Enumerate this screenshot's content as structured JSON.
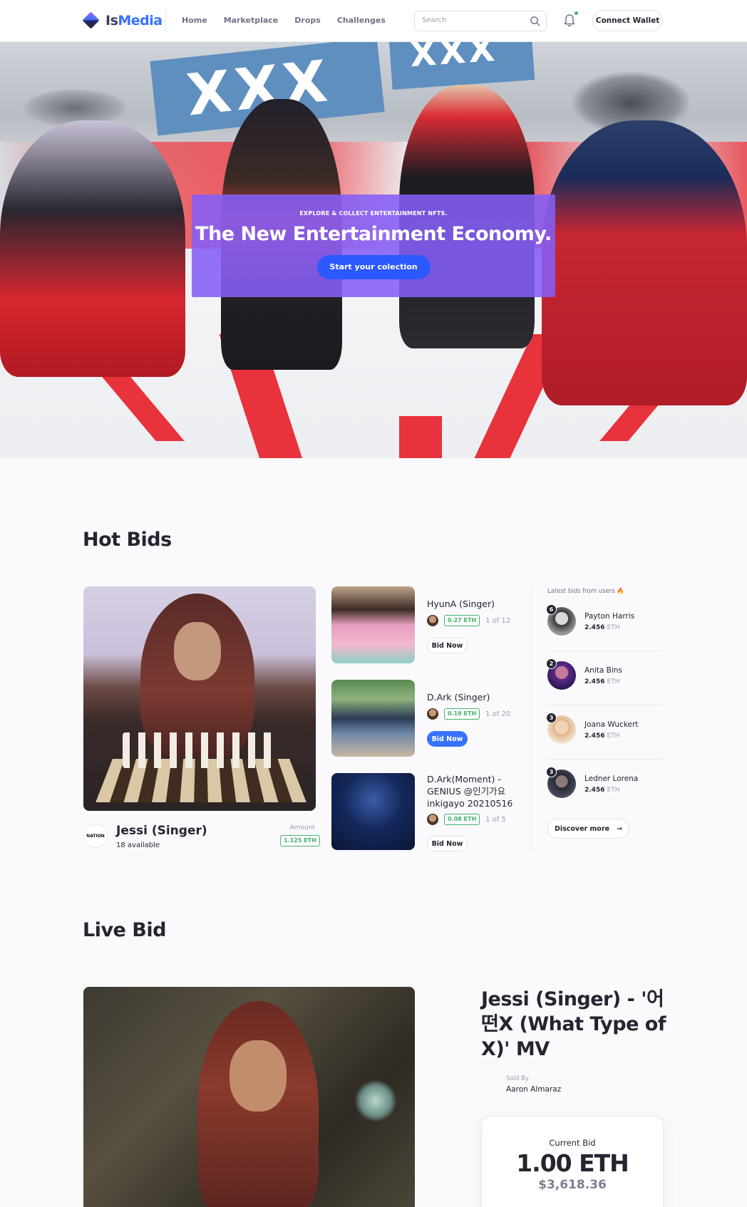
{
  "brand": {
    "name_part1": "Is",
    "name_part2": "Media"
  },
  "nav": [
    "Home",
    "Marketplace",
    "Drops",
    "Challenges"
  ],
  "search": {
    "placeholder": "Search",
    "value": ""
  },
  "header": {
    "connect_label": "Connect Wallet"
  },
  "hero": {
    "kicker": "EXPLORE & COLLECT ENTERTAINMENT NFTS.",
    "title": "The New Entertainment Economy.",
    "cta": "Start your colection",
    "banner_text": "XXX"
  },
  "hot_bids": {
    "title": "Hot Bids",
    "featured": {
      "name": "Jessi (Singer)",
      "available": "18 available",
      "amount_label": "Amount",
      "amount": "1.125 ETH",
      "logo_text": "NATION"
    },
    "items": [
      {
        "title": "HyunA (Singer)",
        "eth": "0.27 ETH",
        "count": "1 of 12",
        "button": "Bid Now",
        "active": false
      },
      {
        "title": "D.Ark (Singer)",
        "eth": "0.19 ETH",
        "count": "1 of 20",
        "button": "Bid Now",
        "active": true
      },
      {
        "title": "D.Ark(Moment) - GENIUS @인기가요 inkigayo 20210516",
        "eth": "0.08 ETH",
        "count": "1 of 5",
        "button": "Bid Now",
        "active": false
      }
    ],
    "latest_label": "Latest bids from users 🔥",
    "users": [
      {
        "rank": "6",
        "name": "Payton Harris",
        "amount": "2.456",
        "unit": "ETH"
      },
      {
        "rank": "2",
        "name": "Anita Bins",
        "amount": "2.456",
        "unit": "ETH"
      },
      {
        "rank": "3",
        "name": "Joana Wuckert",
        "amount": "2.456",
        "unit": "ETH"
      },
      {
        "rank": "3",
        "name": "Ledner Lorena",
        "amount": "2.456",
        "unit": "ETH"
      }
    ],
    "discover": "Discover more"
  },
  "live_bid": {
    "title": "Live Bid",
    "item_title": "Jessi (Singer) - '어떤X (What Type of X)' MV",
    "sold_by_label": "Sold By",
    "seller": "Aaron Almaraz",
    "current_bid_label": "Current Bid",
    "current_bid": "1.00 ETH",
    "usd": "$3,618.36"
  },
  "colors": {
    "accent": "#3772ff",
    "hero_card": "#845ef7",
    "eth_green": "#45b26b",
    "notify_dot": "#45b26b"
  }
}
